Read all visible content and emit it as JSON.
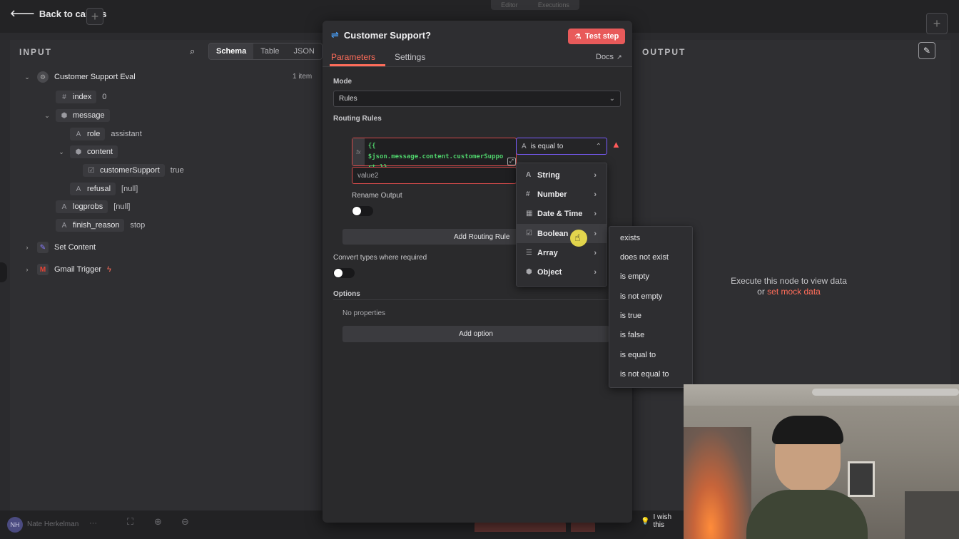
{
  "topbar": {
    "back_label": "Back to canvas",
    "tabs": [
      "Editor",
      "Executions"
    ]
  },
  "input": {
    "title": "INPUT",
    "views": [
      "Schema",
      "Table",
      "JSON"
    ],
    "active_view": "Schema",
    "node_name": "Customer Support Eval",
    "item_count": "1 item",
    "fields": {
      "index": {
        "key": "index",
        "value": "0",
        "icon": "#"
      },
      "message": {
        "key": "message"
      },
      "role": {
        "key": "role",
        "value": "assistant",
        "icon": "A"
      },
      "content": {
        "key": "content"
      },
      "customerSupport": {
        "key": "customerSupport",
        "value": "true"
      },
      "refusal": {
        "key": "refusal",
        "value": "[null]",
        "icon": "A"
      },
      "logprobs": {
        "key": "logprobs",
        "value": "[null]",
        "icon": "A"
      },
      "finish_reason": {
        "key": "finish_reason",
        "value": "stop",
        "icon": "A"
      }
    },
    "other_nodes": [
      "Set Content",
      "Gmail Trigger"
    ]
  },
  "modal": {
    "title": "Customer Support?",
    "test_step_label": "Test step",
    "tabs": [
      "Parameters",
      "Settings"
    ],
    "active_tab": "Parameters",
    "docs_label": "Docs",
    "mode_label": "Mode",
    "mode_value": "Rules",
    "routing_rules_label": "Routing Rules",
    "expr_line1": "{{ $json.message.content.customerSuppo",
    "expr_line2": "rt }}",
    "operator_value": "is equal to",
    "value2_placeholder": "value2",
    "rename_output_label": "Rename Output",
    "add_rule_label": "Add Routing Rule",
    "convert_types_label": "Convert types where required",
    "options_label": "Options",
    "no_properties": "No properties",
    "add_option_label": "Add option"
  },
  "type_menu": [
    {
      "label": "String",
      "icon": "A"
    },
    {
      "label": "Number",
      "icon": "#"
    },
    {
      "label": "Date & Time",
      "icon": "▦"
    },
    {
      "label": "Boolean",
      "icon": "☑"
    },
    {
      "label": "Array",
      "icon": "☰"
    },
    {
      "label": "Object",
      "icon": "⬢"
    }
  ],
  "boolean_submenu": [
    "exists",
    "does not exist",
    "is empty",
    "is not empty",
    "is true",
    "is false",
    "is equal to",
    "is not equal to"
  ],
  "output": {
    "title": "OUTPUT",
    "empty_line1": "Execute this node to view data",
    "empty_or": "or",
    "mock_link": "set mock data"
  },
  "bottombar": {
    "user_initials": "NH",
    "user_name": "Nate Herkelman",
    "tip": "I wish this"
  },
  "colors": {
    "accent": "#ff6d5a",
    "danger": "#e85a5a",
    "expr_green": "#4fd06b"
  }
}
